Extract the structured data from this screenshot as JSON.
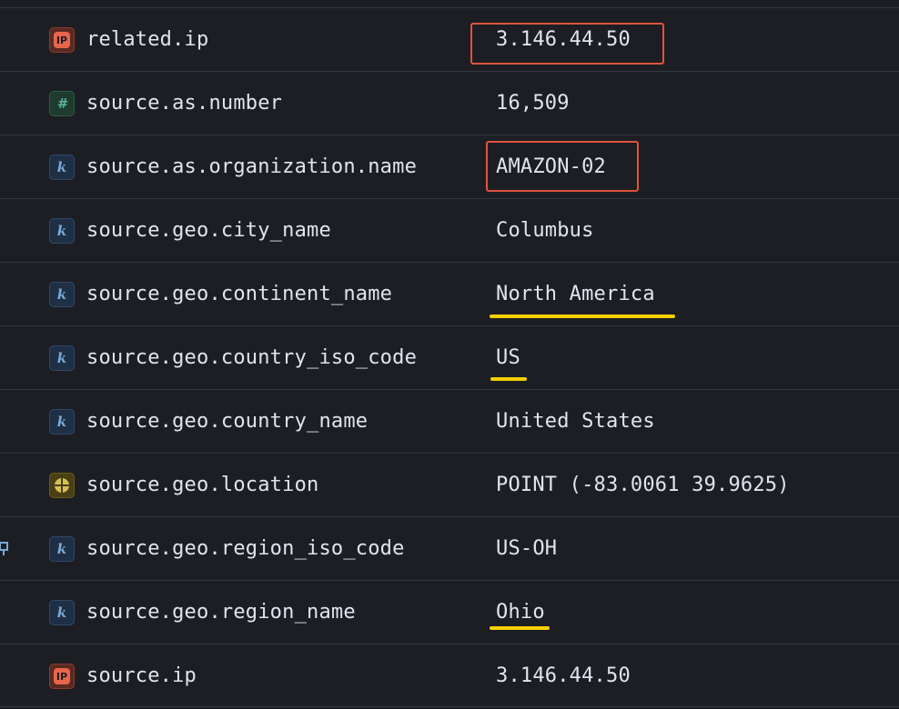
{
  "rows": [
    {
      "type_icon": "ip-field-icon",
      "type_glyph": "IP",
      "field": "related.ip",
      "value": "3.146.44.50"
    },
    {
      "type_icon": "number-field-icon",
      "type_glyph": "#",
      "field": "source.as.number",
      "value": "16,509"
    },
    {
      "type_icon": "keyword-field-icon",
      "type_glyph": "k",
      "field": "source.as.organization.name",
      "value": "AMAZON-02"
    },
    {
      "type_icon": "keyword-field-icon",
      "type_glyph": "k",
      "field": "source.geo.city_name",
      "value": "Columbus"
    },
    {
      "type_icon": "keyword-field-icon",
      "type_glyph": "k",
      "field": "source.geo.continent_name",
      "value": "North America"
    },
    {
      "type_icon": "keyword-field-icon",
      "type_glyph": "k",
      "field": "source.geo.country_iso_code",
      "value": "US"
    },
    {
      "type_icon": "keyword-field-icon",
      "type_glyph": "k",
      "field": "source.geo.country_name",
      "value": "United States"
    },
    {
      "type_icon": "geo-point-field-icon",
      "type_glyph": "",
      "field": "source.geo.location",
      "value": "POINT (-83.0061 39.9625)"
    },
    {
      "type_icon": "keyword-field-icon",
      "type_glyph": "k",
      "field": "source.geo.region_iso_code",
      "value": "US-OH"
    },
    {
      "type_icon": "keyword-field-icon",
      "type_glyph": "k",
      "field": "source.geo.region_name",
      "value": "Ohio"
    },
    {
      "type_icon": "ip-field-icon",
      "type_glyph": "IP",
      "field": "source.ip",
      "value": "3.146.44.50"
    }
  ],
  "colors": {
    "background": "#1d1e24",
    "row_border": "#343741",
    "text": "#dfe5ef",
    "box_highlight": "#e0533d",
    "underline_highlight": "#f5d000"
  }
}
